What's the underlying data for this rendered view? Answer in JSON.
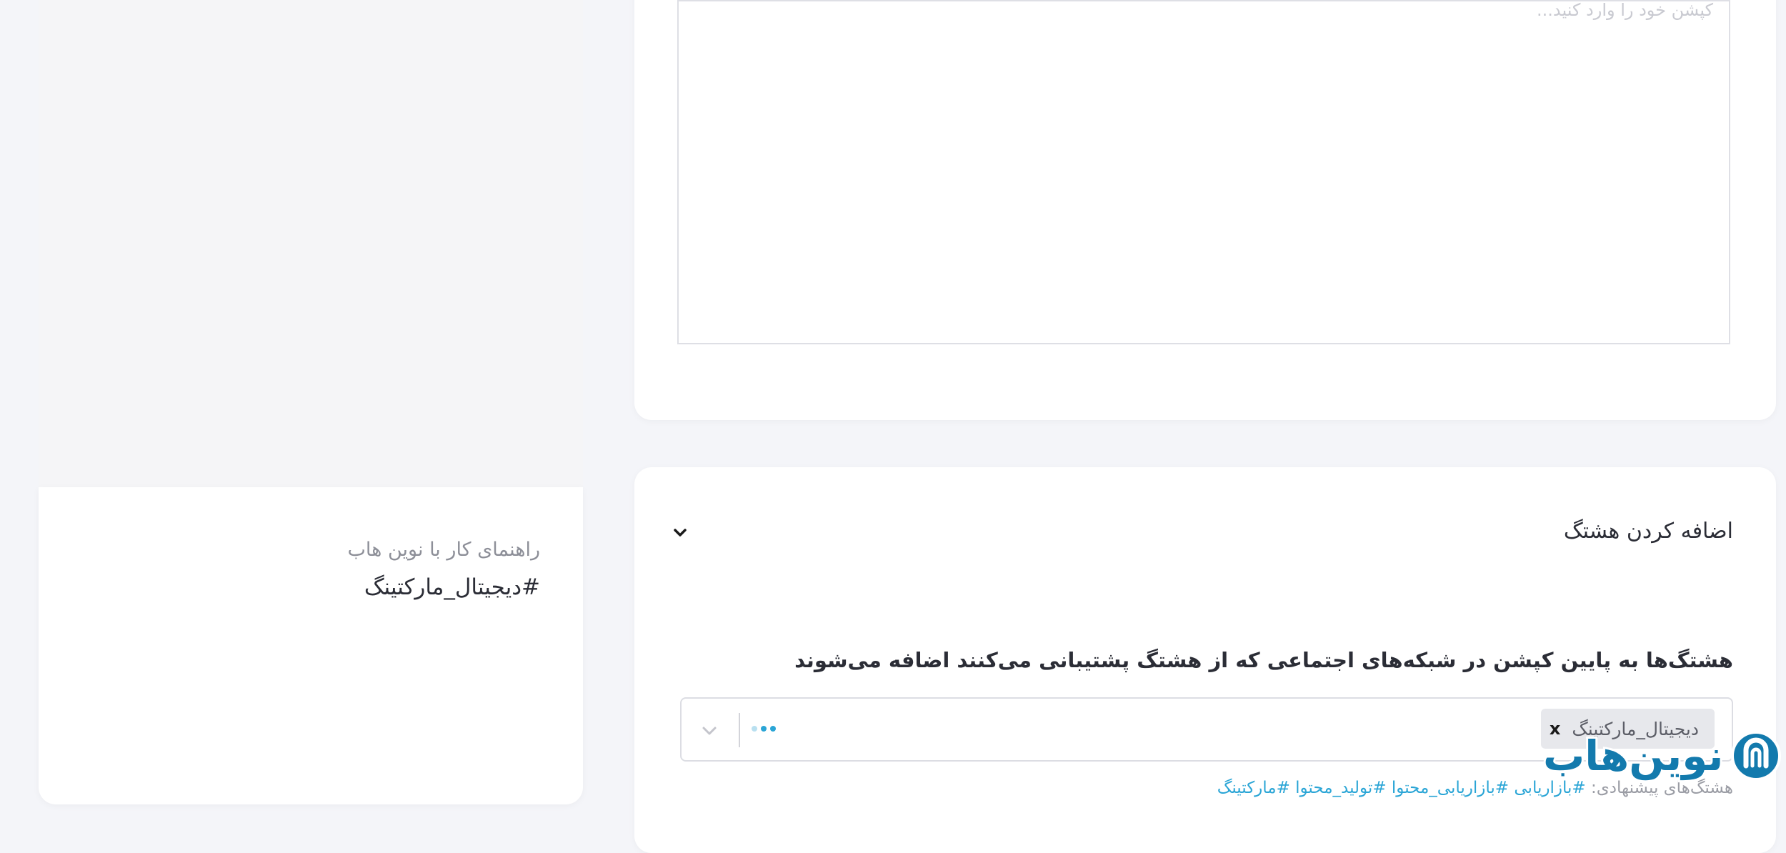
{
  "caption_editor": {
    "placeholder": "کپشن خود را وارد کنید..."
  },
  "hashtag_section": {
    "title": "اضافه کردن هشتگ",
    "description": "هشتگ‌ها به پایین کپشن در شبکه‌های اجتماعی که از هشتگ پشتیبانی می‌کنند اضافه می‌شوند",
    "selected_tags": [
      {
        "label": "دیجیتال_مارکتینگ",
        "remove": "x"
      }
    ],
    "suggested_label": "هشتگ‌های پیشنهادی:",
    "suggested_tags": "#بازاریابی #بازاریابی_محتوا #تولید_محتوا #مارکتینگ"
  },
  "preview_card": {
    "title": "راهنمای کار با نوین هاب",
    "hashtag": "#دیجیتال_مارکتینگ"
  },
  "watermark": {
    "text": "نوین‌هاب",
    "brand_color": "#137aad"
  },
  "colors": {
    "accent": "#2aa5d6",
    "background": "#f4f5f9",
    "card": "#ffffff",
    "text": "#2b2d36",
    "muted": "#9b9da5"
  },
  "icons": {
    "collapse": "chevron-down-icon",
    "select_open": "chevron-down-icon",
    "remove_tag": "close-icon",
    "brand": "logo-icon"
  }
}
